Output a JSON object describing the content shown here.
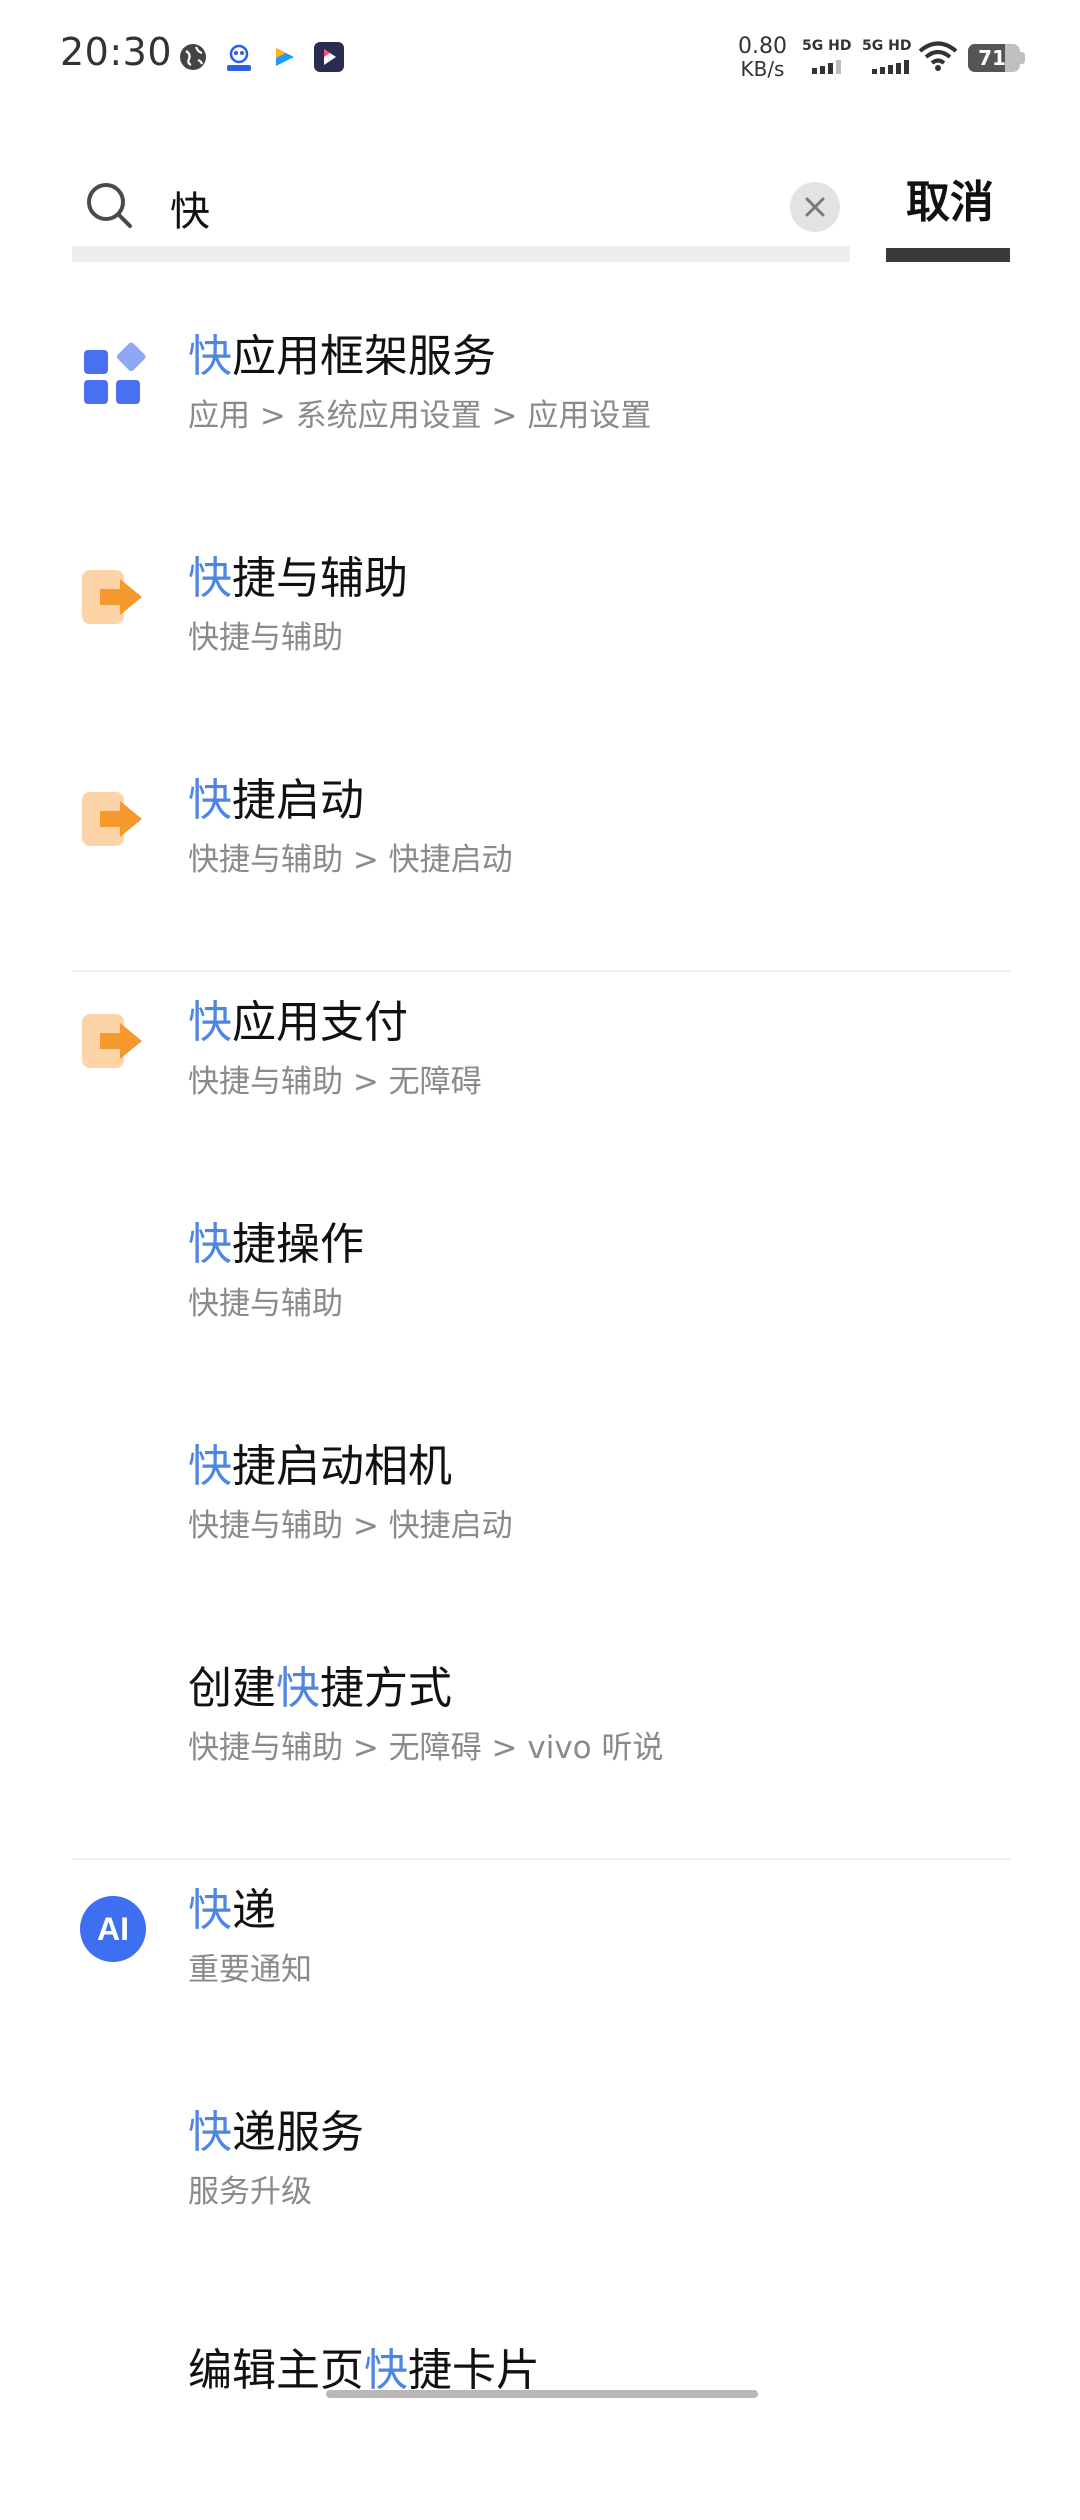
{
  "status_bar": {
    "time": "20:30",
    "net_speed_value": "0.80",
    "net_speed_unit": "KB/s",
    "sim1": "5G HD",
    "sim2": "5G HD",
    "battery": "71",
    "battery_level": 0.71
  },
  "search": {
    "query": "快",
    "placeholder": "",
    "cancel_label": "取消"
  },
  "results": [
    {
      "pre": "",
      "hl": "快",
      "post": "应用框架服务",
      "path": "应用 > 系统应用设置 > 应用设置",
      "icon": "app-grid-icon"
    },
    {
      "pre": "",
      "hl": "快",
      "post": "捷与辅助",
      "path": "快捷与辅助",
      "icon": "shortcut-arrow-icon"
    },
    {
      "pre": "",
      "hl": "快",
      "post": "捷启动",
      "path": "快捷与辅助 > 快捷启动",
      "icon": "shortcut-arrow-icon"
    },
    {
      "pre": "",
      "hl": "快",
      "post": "应用支付",
      "path": "快捷与辅助 > 无障碍",
      "icon": "shortcut-arrow-icon"
    },
    {
      "pre": "",
      "hl": "快",
      "post": "捷操作",
      "path": "快捷与辅助",
      "icon": ""
    },
    {
      "pre": "",
      "hl": "快",
      "post": "捷启动相机",
      "path": "快捷与辅助 > 快捷启动",
      "icon": ""
    },
    {
      "pre": "创建",
      "hl": "快",
      "post": "捷方式",
      "path": "快捷与辅助 > 无障碍 > vivo 听说",
      "icon": ""
    },
    {
      "pre": "",
      "hl": "快",
      "post": "递",
      "path": "重要通知",
      "icon": "ai-badge-icon",
      "icon_text": "AI"
    },
    {
      "pre": "",
      "hl": "快",
      "post": "递服务",
      "path": "服务升级",
      "icon": ""
    },
    {
      "pre": "编辑主页",
      "hl": "快",
      "post": "捷卡片",
      "path": "",
      "icon": ""
    }
  ],
  "colors": {
    "highlight": "#4f86e0",
    "path_text": "#8a8a8a",
    "shortcut_icon_light": "#fdd3a8",
    "shortcut_icon_arrow": "#f5992e",
    "app_grid_blue": "#4a6ff0",
    "ai_badge": "#3d6ff0"
  }
}
